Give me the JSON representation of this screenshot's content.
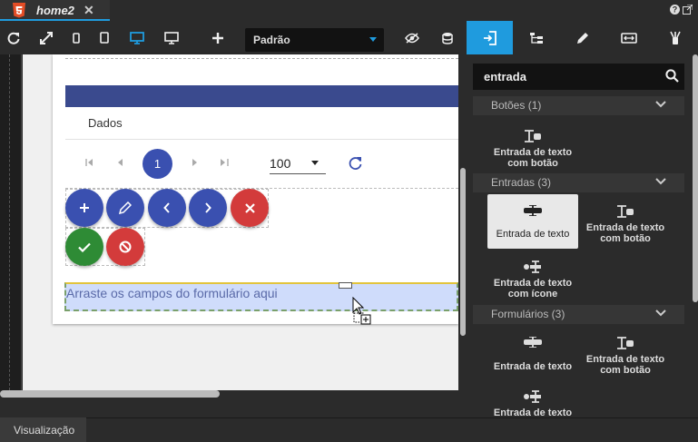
{
  "tab": {
    "title": "home2",
    "close": "✕"
  },
  "toolbar": {
    "device_select": "Padrão"
  },
  "canvas": {
    "tab_label": "Dados",
    "pager": {
      "current_page": "1",
      "page_size": "100"
    },
    "dropzone_text": "Arraste os campos do formulário aqui"
  },
  "panel": {
    "search_value": "entrada",
    "categories": [
      {
        "label": "Botões (1)",
        "items": [
          "Entrada de texto com botão"
        ]
      },
      {
        "label": "Entradas (3)",
        "items": [
          "Entrada de texto",
          "Entrada de texto com botão",
          "Entrada de texto com ícone"
        ]
      },
      {
        "label": "Formulários (3)",
        "items": [
          "Entrada de texto",
          "Entrada de texto com botão",
          "Entrada de texto"
        ]
      }
    ]
  },
  "statusbar": {
    "label": "Visualização"
  },
  "colors": {
    "accent": "#1f9bde",
    "primary": "#3a50b0",
    "danger": "#d33b3b",
    "success": "#2e8b35",
    "appbar": "#3a4a8e"
  }
}
